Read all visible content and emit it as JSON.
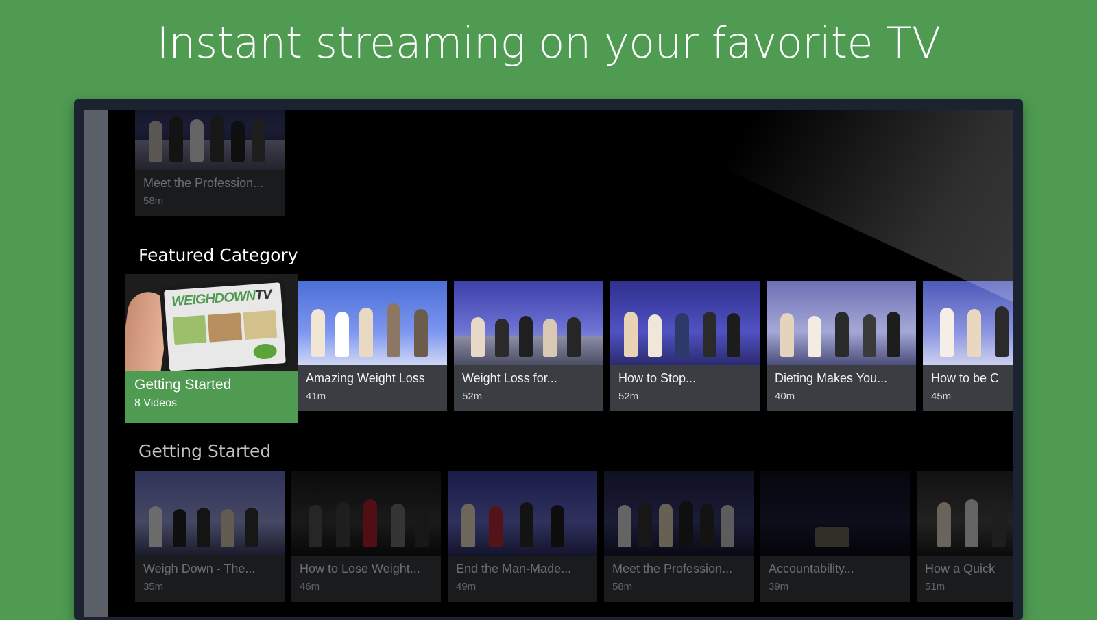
{
  "headline": "Instant streaming on your favorite TV",
  "top_partial": {
    "title": "Meet the Profession...",
    "meta": "58m"
  },
  "featured_row": {
    "heading": "Featured Category",
    "featured": {
      "title": "Getting Started",
      "meta": "8 Videos",
      "logo_text": "WEIGHDOWN",
      "logo_tv": "TV"
    },
    "cards": [
      {
        "title": "Amazing Weight Loss",
        "meta": "41m"
      },
      {
        "title": "Weight Loss for...",
        "meta": "52m"
      },
      {
        "title": "How to Stop...",
        "meta": "52m"
      },
      {
        "title": "Dieting Makes You...",
        "meta": "40m"
      },
      {
        "title": "How to be C",
        "meta": "45m"
      }
    ]
  },
  "second_row": {
    "heading": "Getting Started",
    "cards": [
      {
        "title": "Weigh Down - The...",
        "meta": "35m"
      },
      {
        "title": "How to Lose Weight...",
        "meta": "46m"
      },
      {
        "title": "End the Man-Made...",
        "meta": "49m"
      },
      {
        "title": "Meet the Profession...",
        "meta": "58m"
      },
      {
        "title": "Accountability...",
        "meta": "39m"
      },
      {
        "title": "How a Quick",
        "meta": "51m"
      }
    ]
  },
  "colors": {
    "brand_green": "#4f9b52",
    "card_bg": "#3a3d42"
  }
}
